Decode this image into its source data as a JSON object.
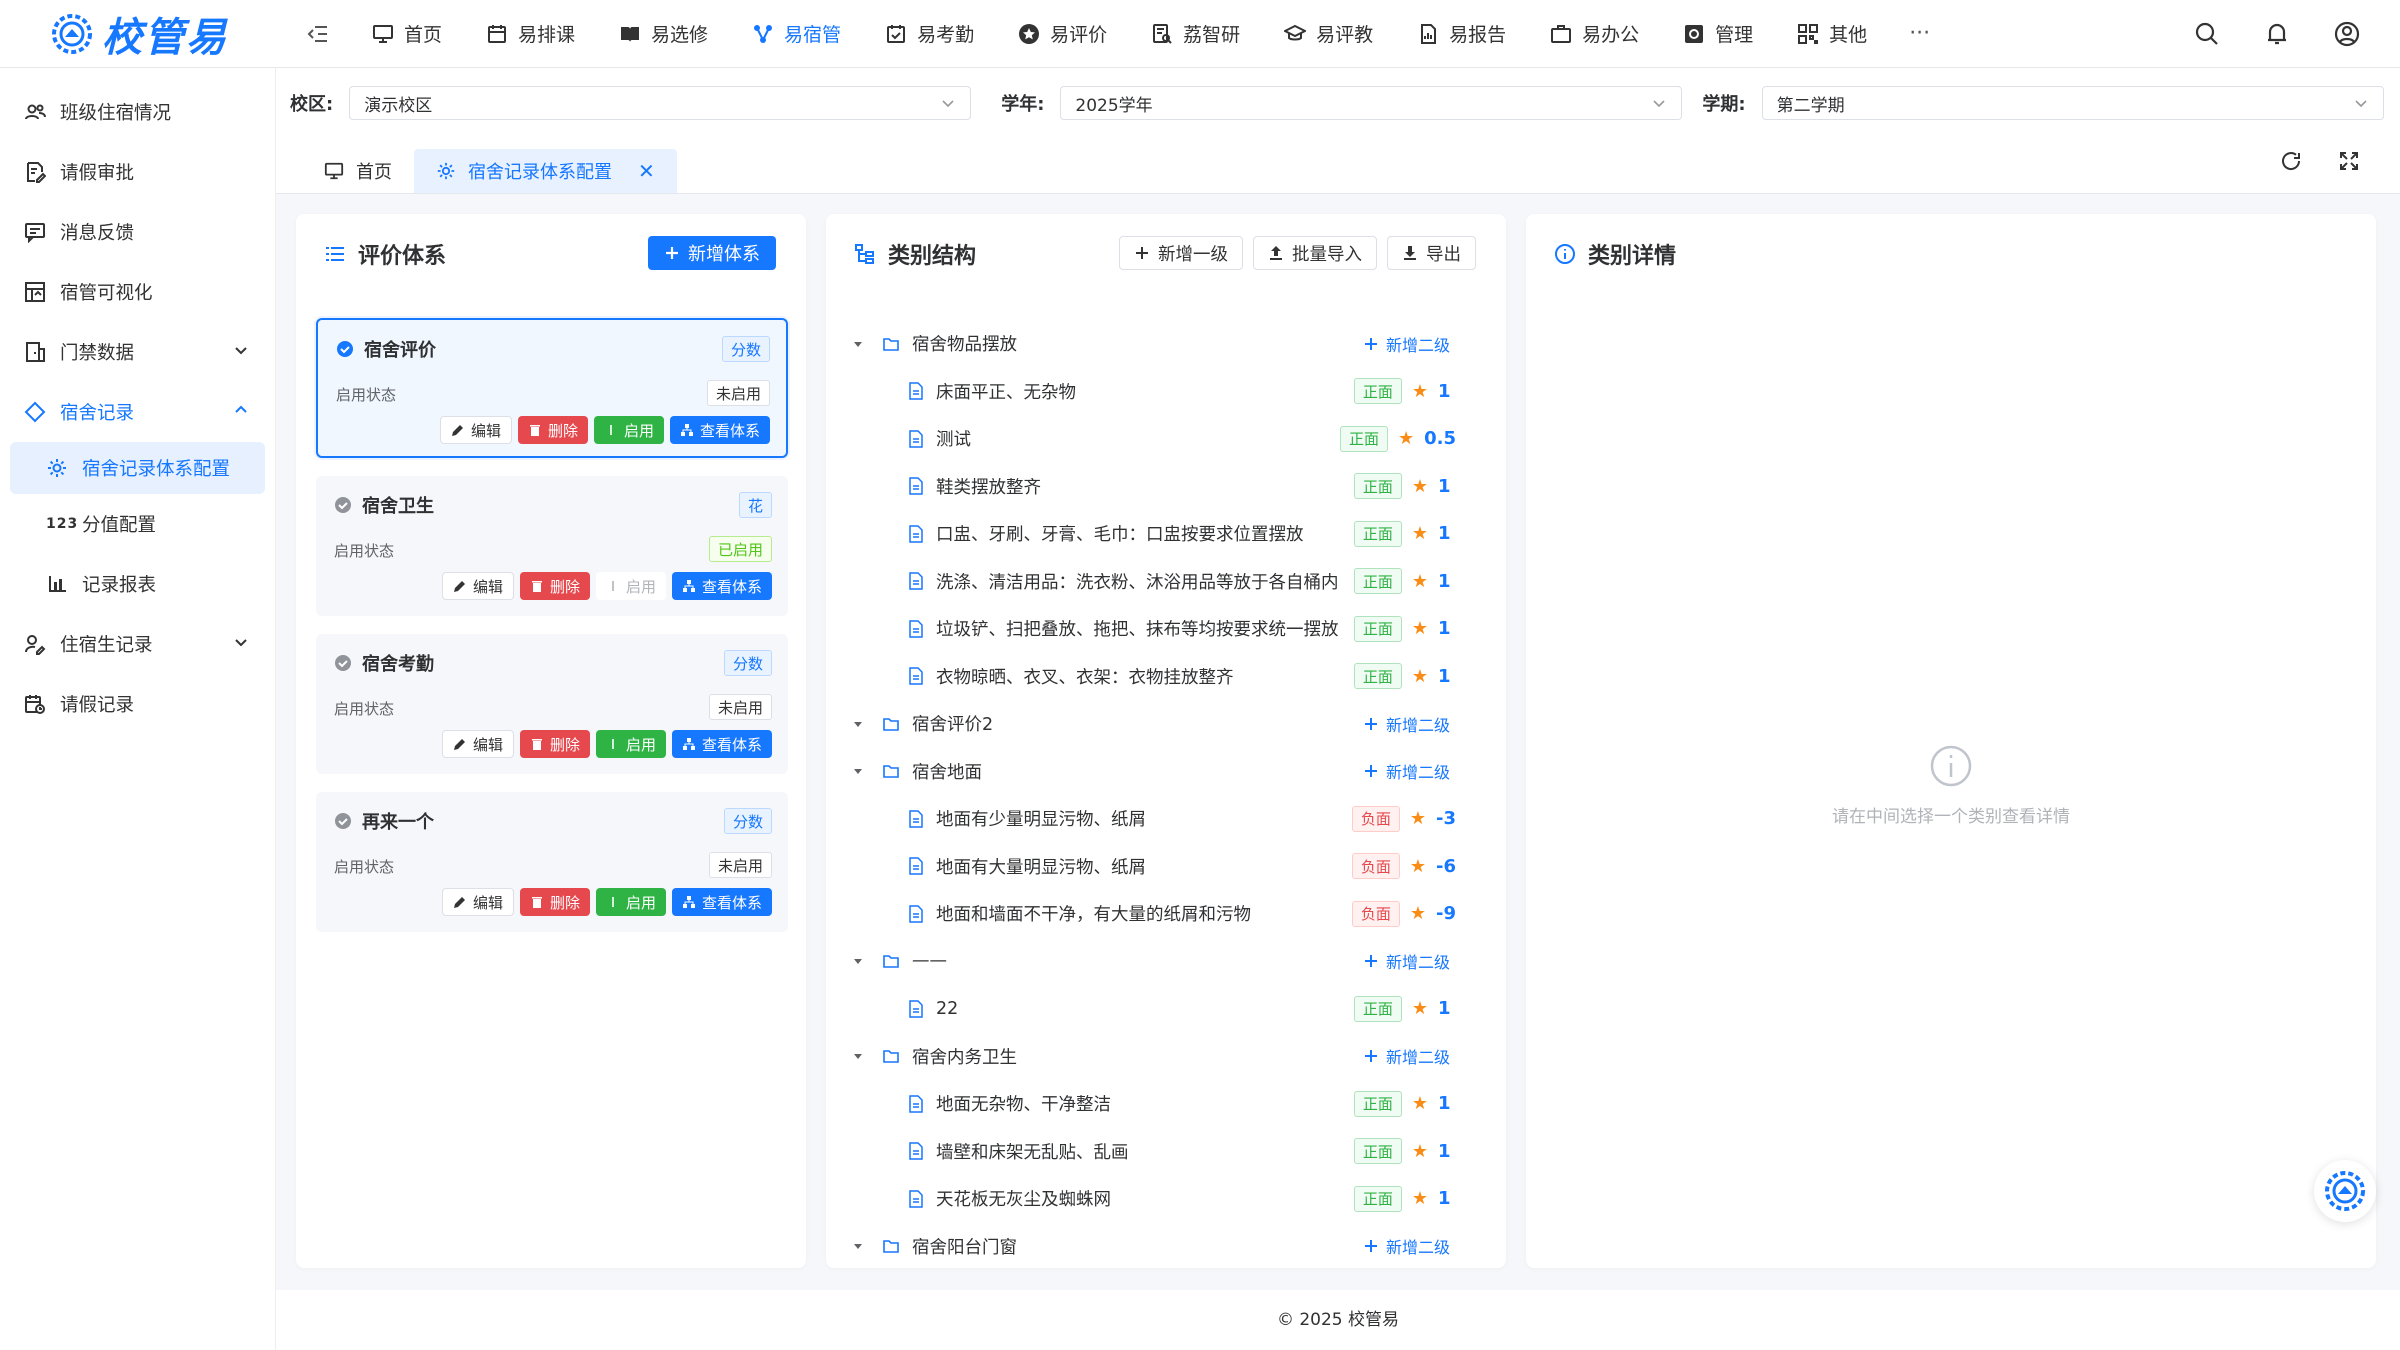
{
  "app": {
    "logo_text": "校管易"
  },
  "nav": {
    "items": [
      {
        "label": "首页",
        "icon": "monitor-icon"
      },
      {
        "label": "易排课",
        "icon": "calendar-icon"
      },
      {
        "label": "易选修",
        "icon": "book-icon"
      },
      {
        "label": "易宿管",
        "icon": "network-icon"
      },
      {
        "label": "易考勤",
        "icon": "calendar-check-icon"
      },
      {
        "label": "易评价",
        "icon": "star-circle-icon"
      },
      {
        "label": "荔智研",
        "icon": "research-icon"
      },
      {
        "label": "易评教",
        "icon": "graduation-cap-icon"
      },
      {
        "label": "易报告",
        "icon": "report-icon"
      },
      {
        "label": "易办公",
        "icon": "briefcase-icon"
      },
      {
        "label": "管理",
        "icon": "settings-square-icon"
      },
      {
        "label": "其他",
        "icon": "grid-icon"
      }
    ],
    "more": "···"
  },
  "sidebar": {
    "items": [
      {
        "label": "班级住宿情况"
      },
      {
        "label": "请假审批"
      },
      {
        "label": "消息反馈"
      },
      {
        "label": "宿管可视化"
      },
      {
        "label": "门禁数据"
      },
      {
        "label": "宿舍记录"
      },
      {
        "label": "宿舍记录体系配置"
      },
      {
        "label": "分值配置",
        "digits": "123"
      },
      {
        "label": "记录报表"
      },
      {
        "label": "住宿生记录"
      },
      {
        "label": "请假记录"
      }
    ]
  },
  "filters": {
    "campus_label": "校区:",
    "campus_value": "演示校区",
    "year_label": "学年:",
    "year_value": "2025学年",
    "term_label": "学期:",
    "term_value": "第二学期"
  },
  "tabs": [
    {
      "label": "首页"
    },
    {
      "label": "宿舍记录体系配置",
      "close": "✕"
    }
  ],
  "left_panel": {
    "title": "评价体系",
    "add_button": "新增体系",
    "status_label": "启用状态",
    "actions": {
      "edit": "编辑",
      "delete": "删除",
      "enable": "启用",
      "view": "查看体系"
    },
    "cards": [
      {
        "name": "宿舍评价",
        "tag": "分数",
        "status": "未启用",
        "enabled": false,
        "selected": true
      },
      {
        "name": "宿舍卫生",
        "tag": "花",
        "status": "已启用",
        "enabled": true,
        "selected": false
      },
      {
        "name": "宿舍考勤",
        "tag": "分数",
        "status": "未启用",
        "enabled": false,
        "selected": false
      },
      {
        "name": "再来一个",
        "tag": "分数",
        "status": "未启用",
        "enabled": false,
        "selected": false
      }
    ]
  },
  "mid_panel": {
    "title": "类别结构",
    "add_first": "新增一级",
    "batch_import": "批量导入",
    "export": "导出",
    "add_second": "新增二级",
    "pos_tag": "正面",
    "neg_tag": "负面",
    "star": "★",
    "tree": [
      {
        "type": "group",
        "label": "宿舍物品摆放"
      },
      {
        "type": "leaf",
        "label": "床面平正、无杂物",
        "polarity": "pos",
        "score": "1"
      },
      {
        "type": "leaf",
        "label": "测试",
        "polarity": "pos",
        "score": "0.5"
      },
      {
        "type": "leaf",
        "label": "鞋类摆放整齐",
        "polarity": "pos",
        "score": "1"
      },
      {
        "type": "leaf",
        "label": "口盅、牙刷、牙膏、毛巾：口盅按要求位置摆放",
        "polarity": "pos",
        "score": "1"
      },
      {
        "type": "leaf",
        "label": "洗涤、清洁用品：洗衣粉、沐浴用品等放于各自桶内",
        "polarity": "pos",
        "score": "1"
      },
      {
        "type": "leaf",
        "label": "垃圾铲、扫把叠放、拖把、抹布等均按要求统一摆放",
        "polarity": "pos",
        "score": "1"
      },
      {
        "type": "leaf",
        "label": "衣物晾晒、衣叉、衣架：衣物挂放整齐",
        "polarity": "pos",
        "score": "1"
      },
      {
        "type": "group",
        "label": "宿舍评价2"
      },
      {
        "type": "group",
        "label": "宿舍地面"
      },
      {
        "type": "leaf",
        "label": "地面有少量明显污物、纸屑",
        "polarity": "neg",
        "score": "-3"
      },
      {
        "type": "leaf",
        "label": "地面有大量明显污物、纸屑",
        "polarity": "neg",
        "score": "-6"
      },
      {
        "type": "leaf",
        "label": "地面和墙面不干净，有大量的纸屑和污物",
        "polarity": "neg",
        "score": "-9"
      },
      {
        "type": "group",
        "label": "——"
      },
      {
        "type": "leaf",
        "label": "22",
        "polarity": "pos",
        "score": "1"
      },
      {
        "type": "group",
        "label": "宿舍内务卫生"
      },
      {
        "type": "leaf",
        "label": "地面无杂物、干净整洁",
        "polarity": "pos",
        "score": "1"
      },
      {
        "type": "leaf",
        "label": "墙壁和床架无乱贴、乱画",
        "polarity": "pos",
        "score": "1"
      },
      {
        "type": "leaf",
        "label": "天花板无灰尘及蜘蛛网",
        "polarity": "pos",
        "score": "1"
      },
      {
        "type": "group",
        "label": "宿舍阳台门窗"
      }
    ]
  },
  "right_panel": {
    "title": "类别详情",
    "empty_text": "请在中间选择一个类别查看详情"
  },
  "footer": {
    "text": "© 2025 校管易"
  },
  "colors": {
    "primary": "#1677ff",
    "success": "#2fb344",
    "danger": "#e5484d",
    "star": "#fa8c16"
  }
}
